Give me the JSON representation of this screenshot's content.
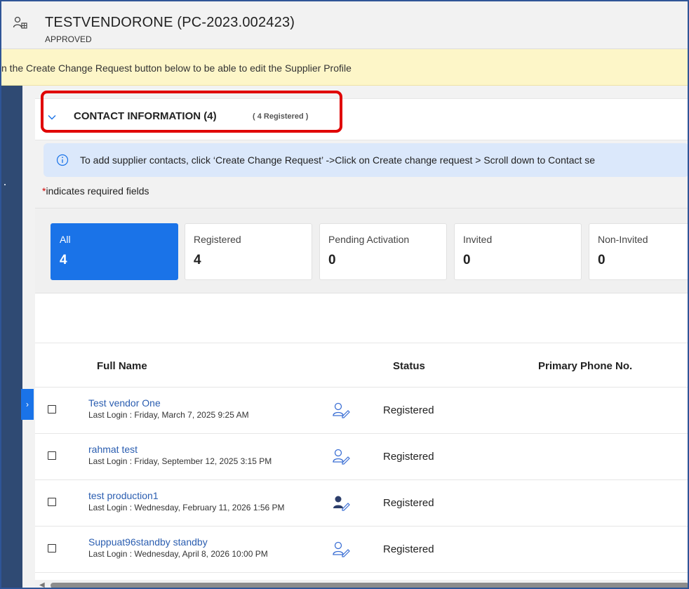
{
  "header": {
    "title": "TESTVENDORONE (PC-2023.002423)",
    "status": "APPROVED",
    "icon": "vendor-org-icon"
  },
  "banner": {
    "text": "n the Create Change Request button below to be able to edit the Supplier Profile"
  },
  "section": {
    "title": "CONTACT INFORMATION (4)",
    "subtitle": "( 4 Registered )",
    "expanded": true
  },
  "info": {
    "text": "To add supplier contacts, click ‘Create Change Request’ ->Click on Create change request > Scroll down to Contact se"
  },
  "required_note": {
    "star": "*",
    "text": "indicates required fields"
  },
  "cards": [
    {
      "label": "All",
      "count": "4",
      "active": true
    },
    {
      "label": "Registered",
      "count": "4",
      "active": false
    },
    {
      "label": "Pending Activation",
      "count": "0",
      "active": false
    },
    {
      "label": "Invited",
      "count": "0",
      "active": false
    },
    {
      "label": "Non-Invited",
      "count": "0",
      "active": false
    }
  ],
  "table": {
    "columns": [
      "Full Name",
      "Status",
      "Primary Phone No."
    ],
    "rows": [
      {
        "name": "Test vendor One",
        "last_login": "Last Login : Friday, March 7, 2025 9:25 AM",
        "icon": "user-edit-outline-icon",
        "status": "Registered"
      },
      {
        "name": "rahmat test",
        "last_login": "Last Login : Friday, September 12, 2025 3:15 PM",
        "icon": "user-edit-outline-icon",
        "status": "Registered"
      },
      {
        "name": "test production1",
        "last_login": "Last Login : Wednesday, February 11, 2026 1:56 PM",
        "icon": "user-edit-filled-icon",
        "status": "Registered"
      },
      {
        "name": "Suppuat96standby standby",
        "last_login": "Last Login : Wednesday, April 8, 2026 10:00 PM",
        "icon": "user-edit-outline-icon",
        "status": "Registered"
      }
    ]
  },
  "colors": {
    "accent": "#1a73e8",
    "link": "#2a5db0",
    "highlight": "#e00000",
    "banner": "#fdf6c8",
    "info": "#dbe8fb"
  }
}
